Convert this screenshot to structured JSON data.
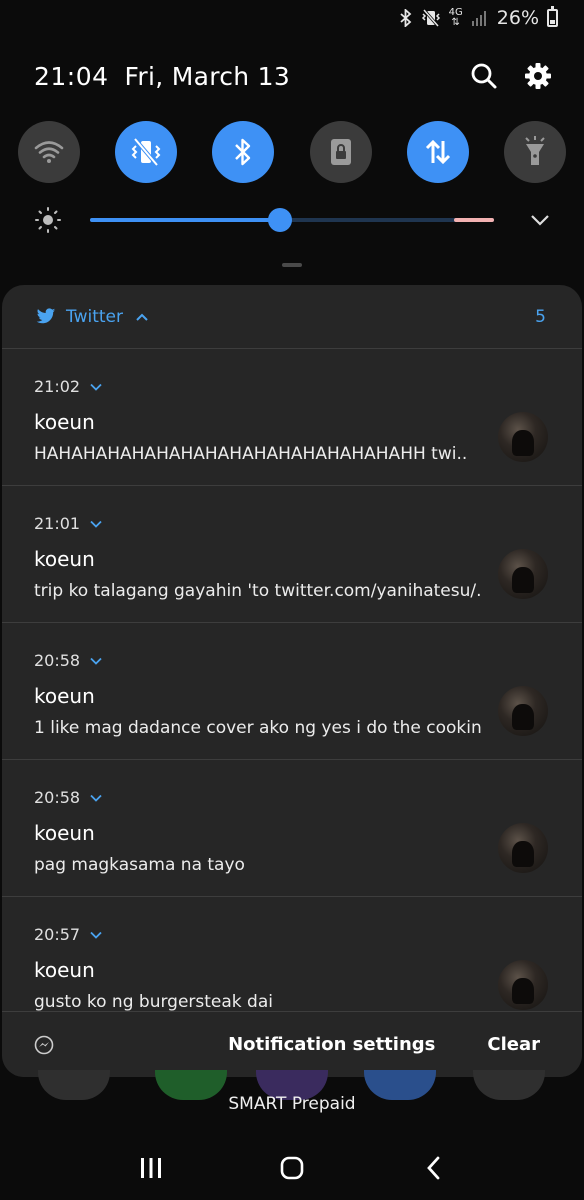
{
  "status_bar": {
    "network": "4G",
    "battery_percent": "26%",
    "icons": [
      "bluetooth-icon",
      "vibrate-mute-icon",
      "4g-data-icon",
      "signal-icon",
      "battery-icon"
    ]
  },
  "header": {
    "time": "21:04",
    "date": "Fri, March 13",
    "icons": [
      "search-icon",
      "settings-icon"
    ]
  },
  "quick_toggles": [
    {
      "name": "wifi",
      "icon": "wifi-icon",
      "state": "off"
    },
    {
      "name": "sound",
      "icon": "vibrate-icon",
      "state": "on"
    },
    {
      "name": "bluetooth",
      "icon": "bluetooth-icon",
      "state": "on"
    },
    {
      "name": "rotation-lock",
      "icon": "rotation-lock-icon",
      "state": "off"
    },
    {
      "name": "mobile-data",
      "icon": "mobile-data-icon",
      "state": "on"
    },
    {
      "name": "flashlight",
      "icon": "flashlight-icon",
      "state": "off"
    }
  ],
  "brightness": {
    "level": 0.47
  },
  "notifications": {
    "app_name": "Twitter",
    "count": "5",
    "items": [
      {
        "time": "21:02",
        "title": "koeun",
        "text": "HAHAHAHAHAHAHAHAHAHAHAHAHAHAHAHH twi.."
      },
      {
        "time": "21:01",
        "title": "koeun",
        "text": "trip ko talagang gayahin 'to twitter.com/yanihatesu/.."
      },
      {
        "time": "20:58",
        "title": "koeun",
        "text": "1 like mag dadance cover ako ng yes i do the cookin.."
      },
      {
        "time": "20:58",
        "title": "koeun",
        "text": "pag magkasama na tayo"
      },
      {
        "time": "20:57",
        "title": "koeun",
        "text": "gusto ko ng burgersteak dai"
      }
    ],
    "footer": {
      "settings_label": "Notification settings",
      "clear_label": "Clear"
    }
  },
  "carrier": "SMART Prepaid",
  "colors": {
    "accent": "#3e91f5",
    "twitter_blue": "#4aa3f0",
    "panel_bg": "#262626",
    "toggle_off": "#3b3b3b"
  }
}
